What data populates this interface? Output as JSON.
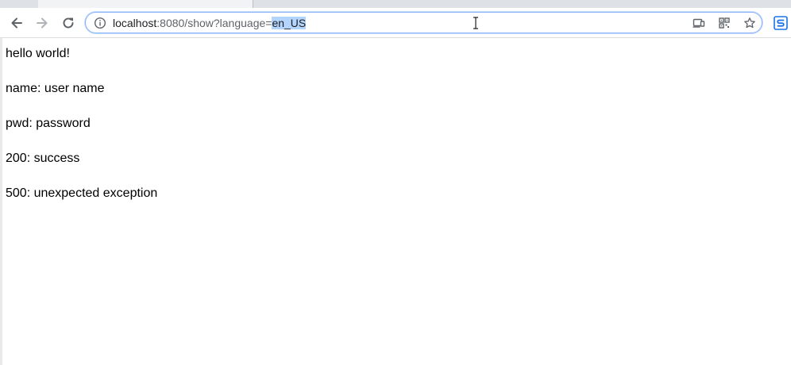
{
  "browser": {
    "address_bar": {
      "url_host": "localhost",
      "url_path": ":8080/show?language=",
      "url_selected": "en_US"
    },
    "icons": {
      "back": "arrow-left-icon",
      "forward": "arrow-right-icon",
      "reload": "reload-icon",
      "site_info": "info-circle-icon",
      "cast": "cast-icon",
      "qr": "qr-code-icon",
      "bookmark": "star-icon",
      "extension": "extension-icon"
    },
    "colors": {
      "focus_ring": "#8ab4f8",
      "selection": "#b3d4fc",
      "extension_accent": "#1a73e8"
    }
  },
  "page": {
    "lines": [
      "hello world!",
      "name: user name",
      "pwd: password",
      "200: success",
      "500: unexpected exception"
    ]
  }
}
